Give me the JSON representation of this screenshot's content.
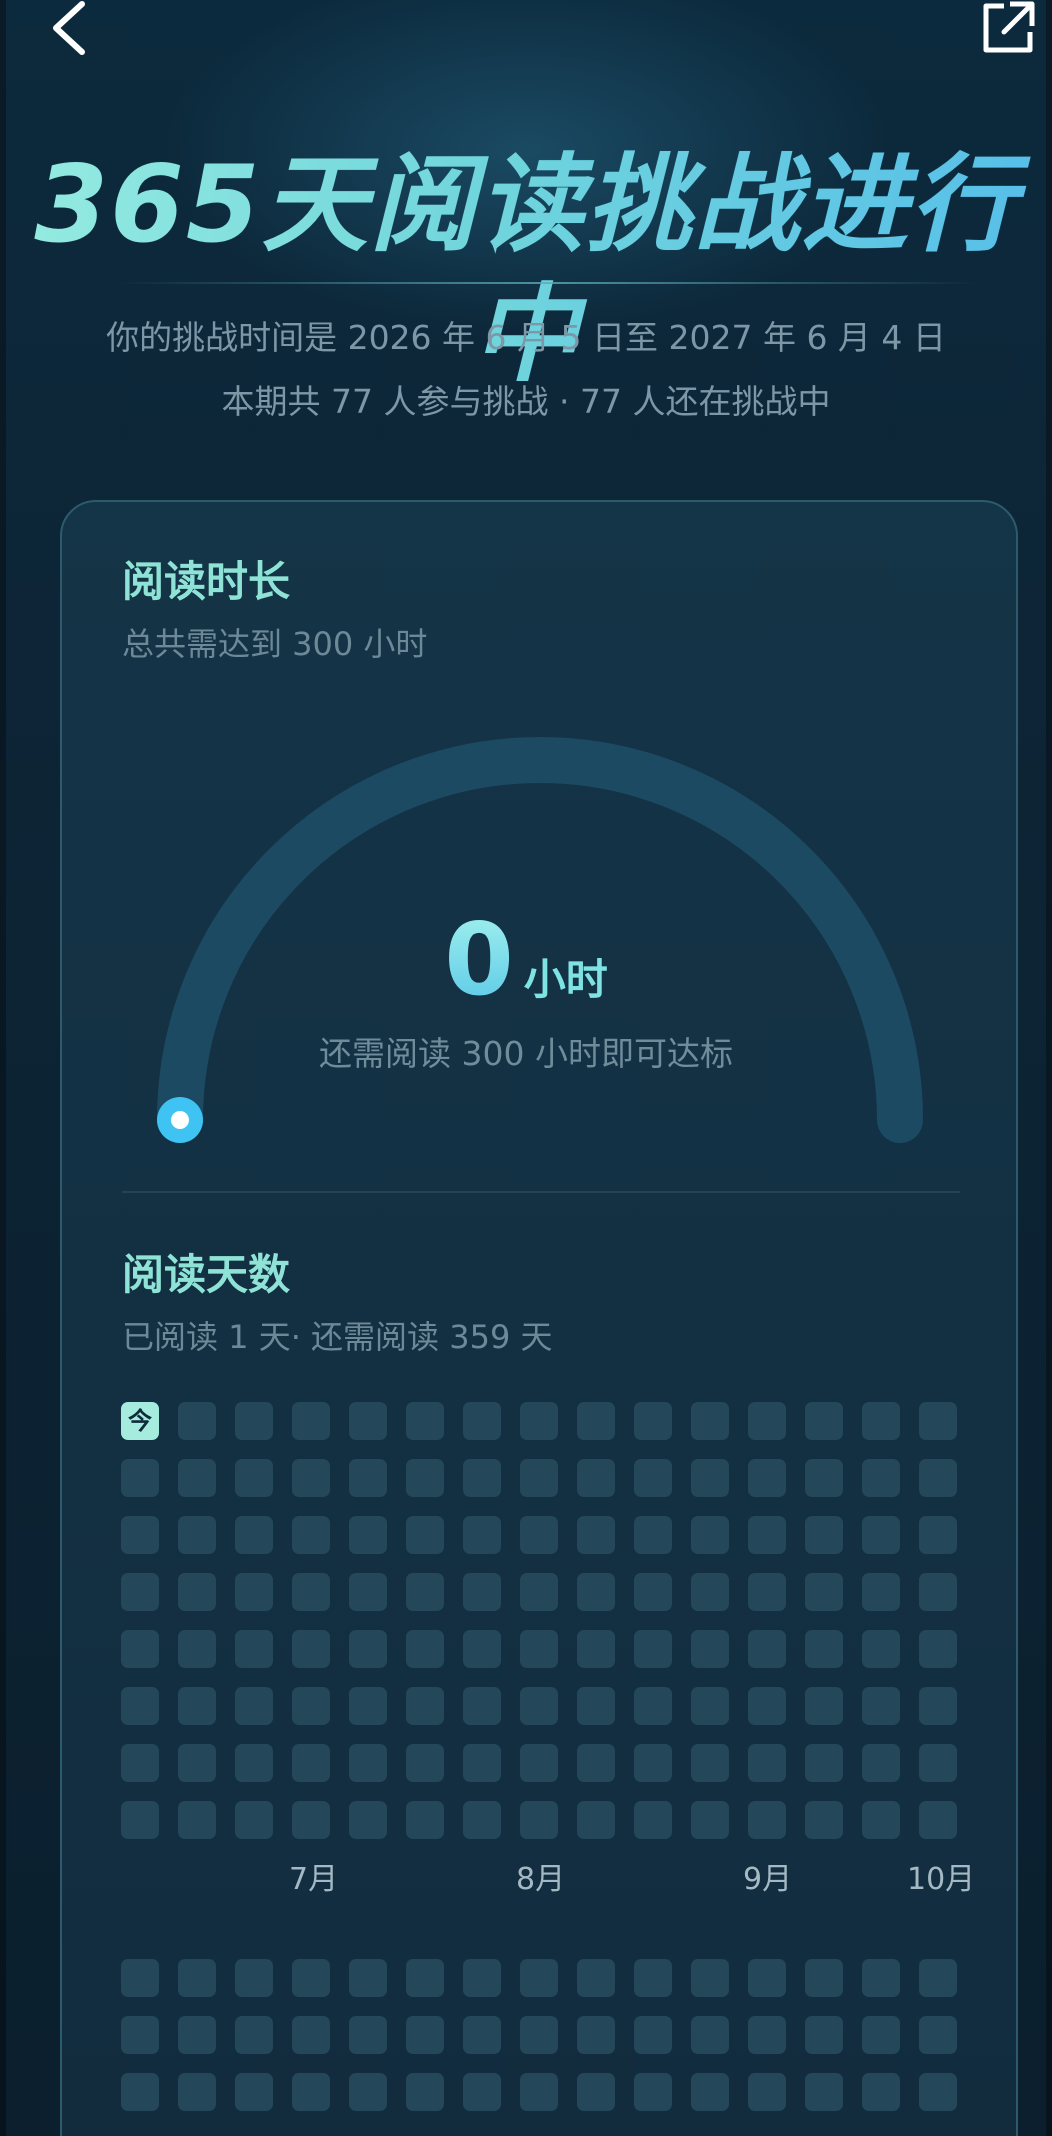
{
  "nav": {
    "back_icon": "chevron-left-icon",
    "share_icon": "share-external-icon"
  },
  "header": {
    "title": "365天阅读挑战进行中",
    "challenge_period": "你的挑战时间是 2026 年 6 月 5 日至 2027 年 6 月 4 日",
    "participants": "本期共 77 人参与挑战 · 77 人还在挑战中"
  },
  "reading_duration": {
    "title": "阅读时长",
    "subtitle": "总共需达到 300 小时",
    "value": "0",
    "unit": "小时",
    "progress_fraction": 0,
    "note": "还需阅读 300 小时即可达标"
  },
  "reading_days": {
    "title": "阅读天数",
    "subtitle": "已阅读 1 天· 还需阅读 359 天",
    "today_label": "今",
    "month_labels": [
      "7月",
      "8月",
      "9月",
      "10月"
    ]
  },
  "colors": {
    "accent": "#8fe3d6",
    "gauge_track": "#1c4a62",
    "gauge_dot": "#3ec3f3",
    "cell_empty": "#24475a",
    "cell_today": "#a5ecdf"
  }
}
